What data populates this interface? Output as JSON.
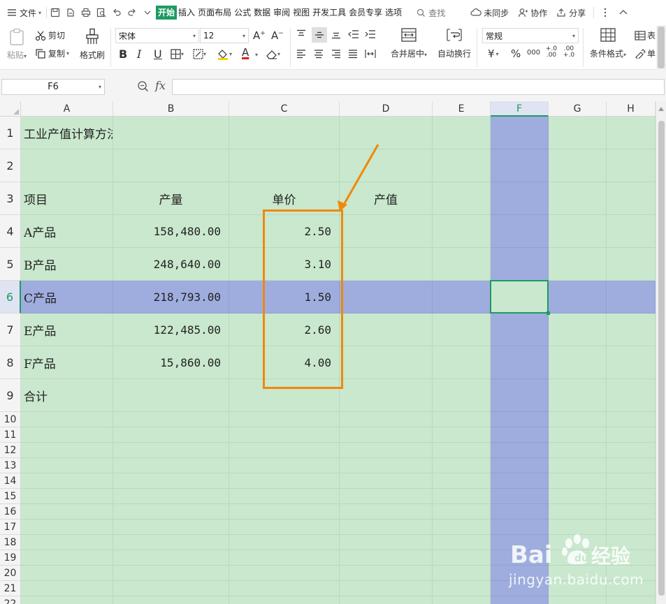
{
  "menubar": {
    "file_label": "文件",
    "tabs": [
      "开始",
      "插入",
      "页面布局",
      "公式",
      "数据",
      "审阅",
      "视图",
      "开发工具",
      "会员专享",
      "选项"
    ],
    "active_tab": "开始",
    "search_label": "查找",
    "sync_label": "未同步",
    "collab_label": "协作",
    "share_label": "分享"
  },
  "ribbon": {
    "paste_label": "粘贴",
    "cut_label": "剪切",
    "copy_label": "复制",
    "format_painter_label": "格式刷",
    "font_name": "宋体",
    "font_size": "12",
    "merge_center_label": "合并居中",
    "wrap_text_label": "自动换行",
    "number_format": "常规",
    "conditional_format_label": "条件格式",
    "table_style_label": "表",
    "cell_style_label": "单",
    "bold": "B",
    "italic": "I",
    "underline": "U",
    "font_color_label": "A",
    "increase_font": "A⁺",
    "decrease_font": "A⁻",
    "currency_symbol": "¥",
    "percent_symbol": "%",
    "thousands_symbol": "000",
    "decimal_increase": "+.0 .00",
    "decimal_decrease": ".00 +.0",
    "accent_color": "#1d9b62"
  },
  "formula_bar": {
    "name_box": "F6",
    "fx_label": "fx",
    "formula": ""
  },
  "sheet": {
    "columns": [
      "A",
      "B",
      "C",
      "D",
      "E",
      "F",
      "G",
      "H"
    ],
    "selected_column": "F",
    "selected_row": "6",
    "rows": [
      {
        "num": "1",
        "cells": [
          "工业产值计算方法",
          "",
          "",
          "",
          "",
          "",
          "",
          ""
        ]
      },
      {
        "num": "2",
        "cells": [
          "",
          "",
          "",
          "",
          "",
          "",
          "",
          ""
        ]
      },
      {
        "num": "3",
        "cells": [
          "项目",
          "产量",
          "单价",
          "产值",
          "",
          "",
          "",
          ""
        ]
      },
      {
        "num": "4",
        "cells": [
          "A产品",
          "158,480.00",
          "2.50",
          "",
          "",
          "",
          "",
          ""
        ]
      },
      {
        "num": "5",
        "cells": [
          "B产品",
          "248,640.00",
          "3.10",
          "",
          "",
          "",
          "",
          ""
        ]
      },
      {
        "num": "6",
        "cells": [
          "C产品",
          "218,793.00",
          "1.50",
          "",
          "",
          "",
          "",
          ""
        ]
      },
      {
        "num": "7",
        "cells": [
          "E产品",
          "122,485.00",
          "2.60",
          "",
          "",
          "",
          "",
          ""
        ]
      },
      {
        "num": "8",
        "cells": [
          "F产品",
          "15,860.00",
          "4.00",
          "",
          "",
          "",
          "",
          ""
        ]
      },
      {
        "num": "9",
        "cells": [
          "合计",
          "",
          "",
          "",
          "",
          "",
          "",
          ""
        ]
      },
      {
        "num": "10",
        "cells": [
          "",
          "",
          "",
          "",
          "",
          "",
          "",
          ""
        ]
      },
      {
        "num": "11",
        "cells": [
          "",
          "",
          "",
          "",
          "",
          "",
          "",
          ""
        ]
      },
      {
        "num": "12",
        "cells": [
          "",
          "",
          "",
          "",
          "",
          "",
          "",
          ""
        ]
      },
      {
        "num": "13",
        "cells": [
          "",
          "",
          "",
          "",
          "",
          "",
          "",
          ""
        ]
      },
      {
        "num": "14",
        "cells": [
          "",
          "",
          "",
          "",
          "",
          "",
          "",
          ""
        ]
      },
      {
        "num": "15",
        "cells": [
          "",
          "",
          "",
          "",
          "",
          "",
          "",
          ""
        ]
      },
      {
        "num": "16",
        "cells": [
          "",
          "",
          "",
          "",
          "",
          "",
          "",
          ""
        ]
      },
      {
        "num": "17",
        "cells": [
          "",
          "",
          "",
          "",
          "",
          "",
          "",
          ""
        ]
      },
      {
        "num": "18",
        "cells": [
          "",
          "",
          "",
          "",
          "",
          "",
          "",
          ""
        ]
      },
      {
        "num": "19",
        "cells": [
          "",
          "",
          "",
          "",
          "",
          "",
          "",
          ""
        ]
      },
      {
        "num": "20",
        "cells": [
          "",
          "",
          "",
          "",
          "",
          "",
          "",
          ""
        ]
      },
      {
        "num": "21",
        "cells": [
          "",
          "",
          "",
          "",
          "",
          "",
          "",
          ""
        ]
      },
      {
        "num": "22",
        "cells": [
          "",
          "",
          "",
          "",
          "",
          "",
          "",
          ""
        ]
      }
    ],
    "cell_bg_color": "#c9e8cd",
    "selection_color": "#9fadde",
    "annotation_color": "#f0880a"
  },
  "watermark": {
    "logo_text": "Bai du 经验",
    "url": "jingyan.baidu.com"
  }
}
